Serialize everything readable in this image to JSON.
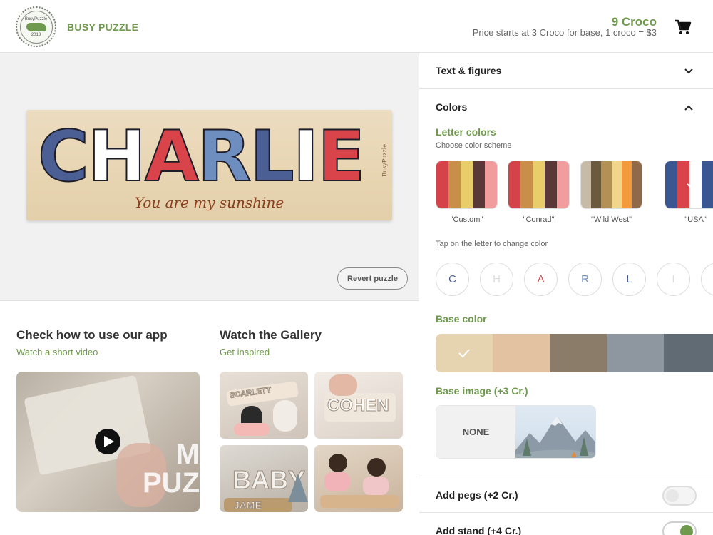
{
  "header": {
    "brand": "BUSY PUZZLE",
    "logo_top": "BusyPuzzle",
    "logo_year": "2018",
    "croco_count": "9 Croco",
    "price_note": "Price starts at 3 Croco for base, 1 croco = $3",
    "cart_icon": "cart-icon"
  },
  "preview": {
    "letters": [
      {
        "char": "C",
        "color": "#4c5f94"
      },
      {
        "char": "H",
        "color": "#ffffff"
      },
      {
        "char": "A",
        "color": "#d9434a"
      },
      {
        "char": "R",
        "color": "#6e8ebf"
      },
      {
        "char": "L",
        "color": "#4c5f94"
      },
      {
        "char": "I",
        "color": "#ffffff"
      },
      {
        "char": "E",
        "color": "#d9434a"
      }
    ],
    "caption": "You are my sunshine",
    "board_brand": "BusyPuzzle",
    "revert_label": "Revert puzzle"
  },
  "howto": {
    "title": "Check how to use our app",
    "subtitle": "Watch a short video",
    "video_text_1": "M",
    "video_text_2": "PUZ"
  },
  "gallery": {
    "title": "Watch the Gallery",
    "subtitle": "Get inspired",
    "thumb_words": [
      "SCARLETT",
      "COHEN",
      "BABY",
      "JAME"
    ]
  },
  "panel": {
    "text_figures_label": "Text & figures",
    "colors_label": "Colors",
    "letter_colors_label": "Letter colors",
    "choose_scheme_note": "Choose color scheme",
    "schemes": [
      {
        "label": "\"Custom\"",
        "colors": [
          "#d4434a",
          "#c98e47",
          "#e8cd6a",
          "#5b3838",
          "#f19c9d"
        ]
      },
      {
        "label": "\"Conrad\"",
        "colors": [
          "#d4434a",
          "#c98e47",
          "#e8cd6a",
          "#5b3838",
          "#f19c9d"
        ]
      },
      {
        "label": "\"Wild West\"",
        "colors": [
          "#c7bba7",
          "#6b5a3d",
          "#b39056",
          "#f0d58a",
          "#f39a3c",
          "#8e6a48"
        ]
      },
      {
        "label": "\"USA\"",
        "colors": [
          "#3b5791",
          "#d9434a",
          "#ffffff",
          "#3b5791",
          "#6e8ebf"
        ]
      }
    ],
    "tap_note": "Tap on the letter to change color",
    "letter_chips": [
      {
        "char": "C",
        "color": "#4c5f94"
      },
      {
        "char": "H",
        "color": "#dddddd"
      },
      {
        "char": "A",
        "color": "#d9434a"
      },
      {
        "char": "R",
        "color": "#6e8ebf"
      },
      {
        "char": "L",
        "color": "#4c5f94"
      },
      {
        "char": "I",
        "color": "#dddddd"
      }
    ],
    "base_color_label": "Base color",
    "base_colors": [
      "#e6d3b0",
      "#e2c2a1",
      "#8b7c6a",
      "#8e96a0",
      "#616b74"
    ],
    "base_image_label": "Base image (+3 Cr.)",
    "base_image_none": "NONE",
    "add_pegs_label": "Add pegs (+2 Cr.)",
    "add_stand_label": "Add stand (+4 Cr.)"
  },
  "colors": {
    "accent": "#6f9a4d"
  }
}
